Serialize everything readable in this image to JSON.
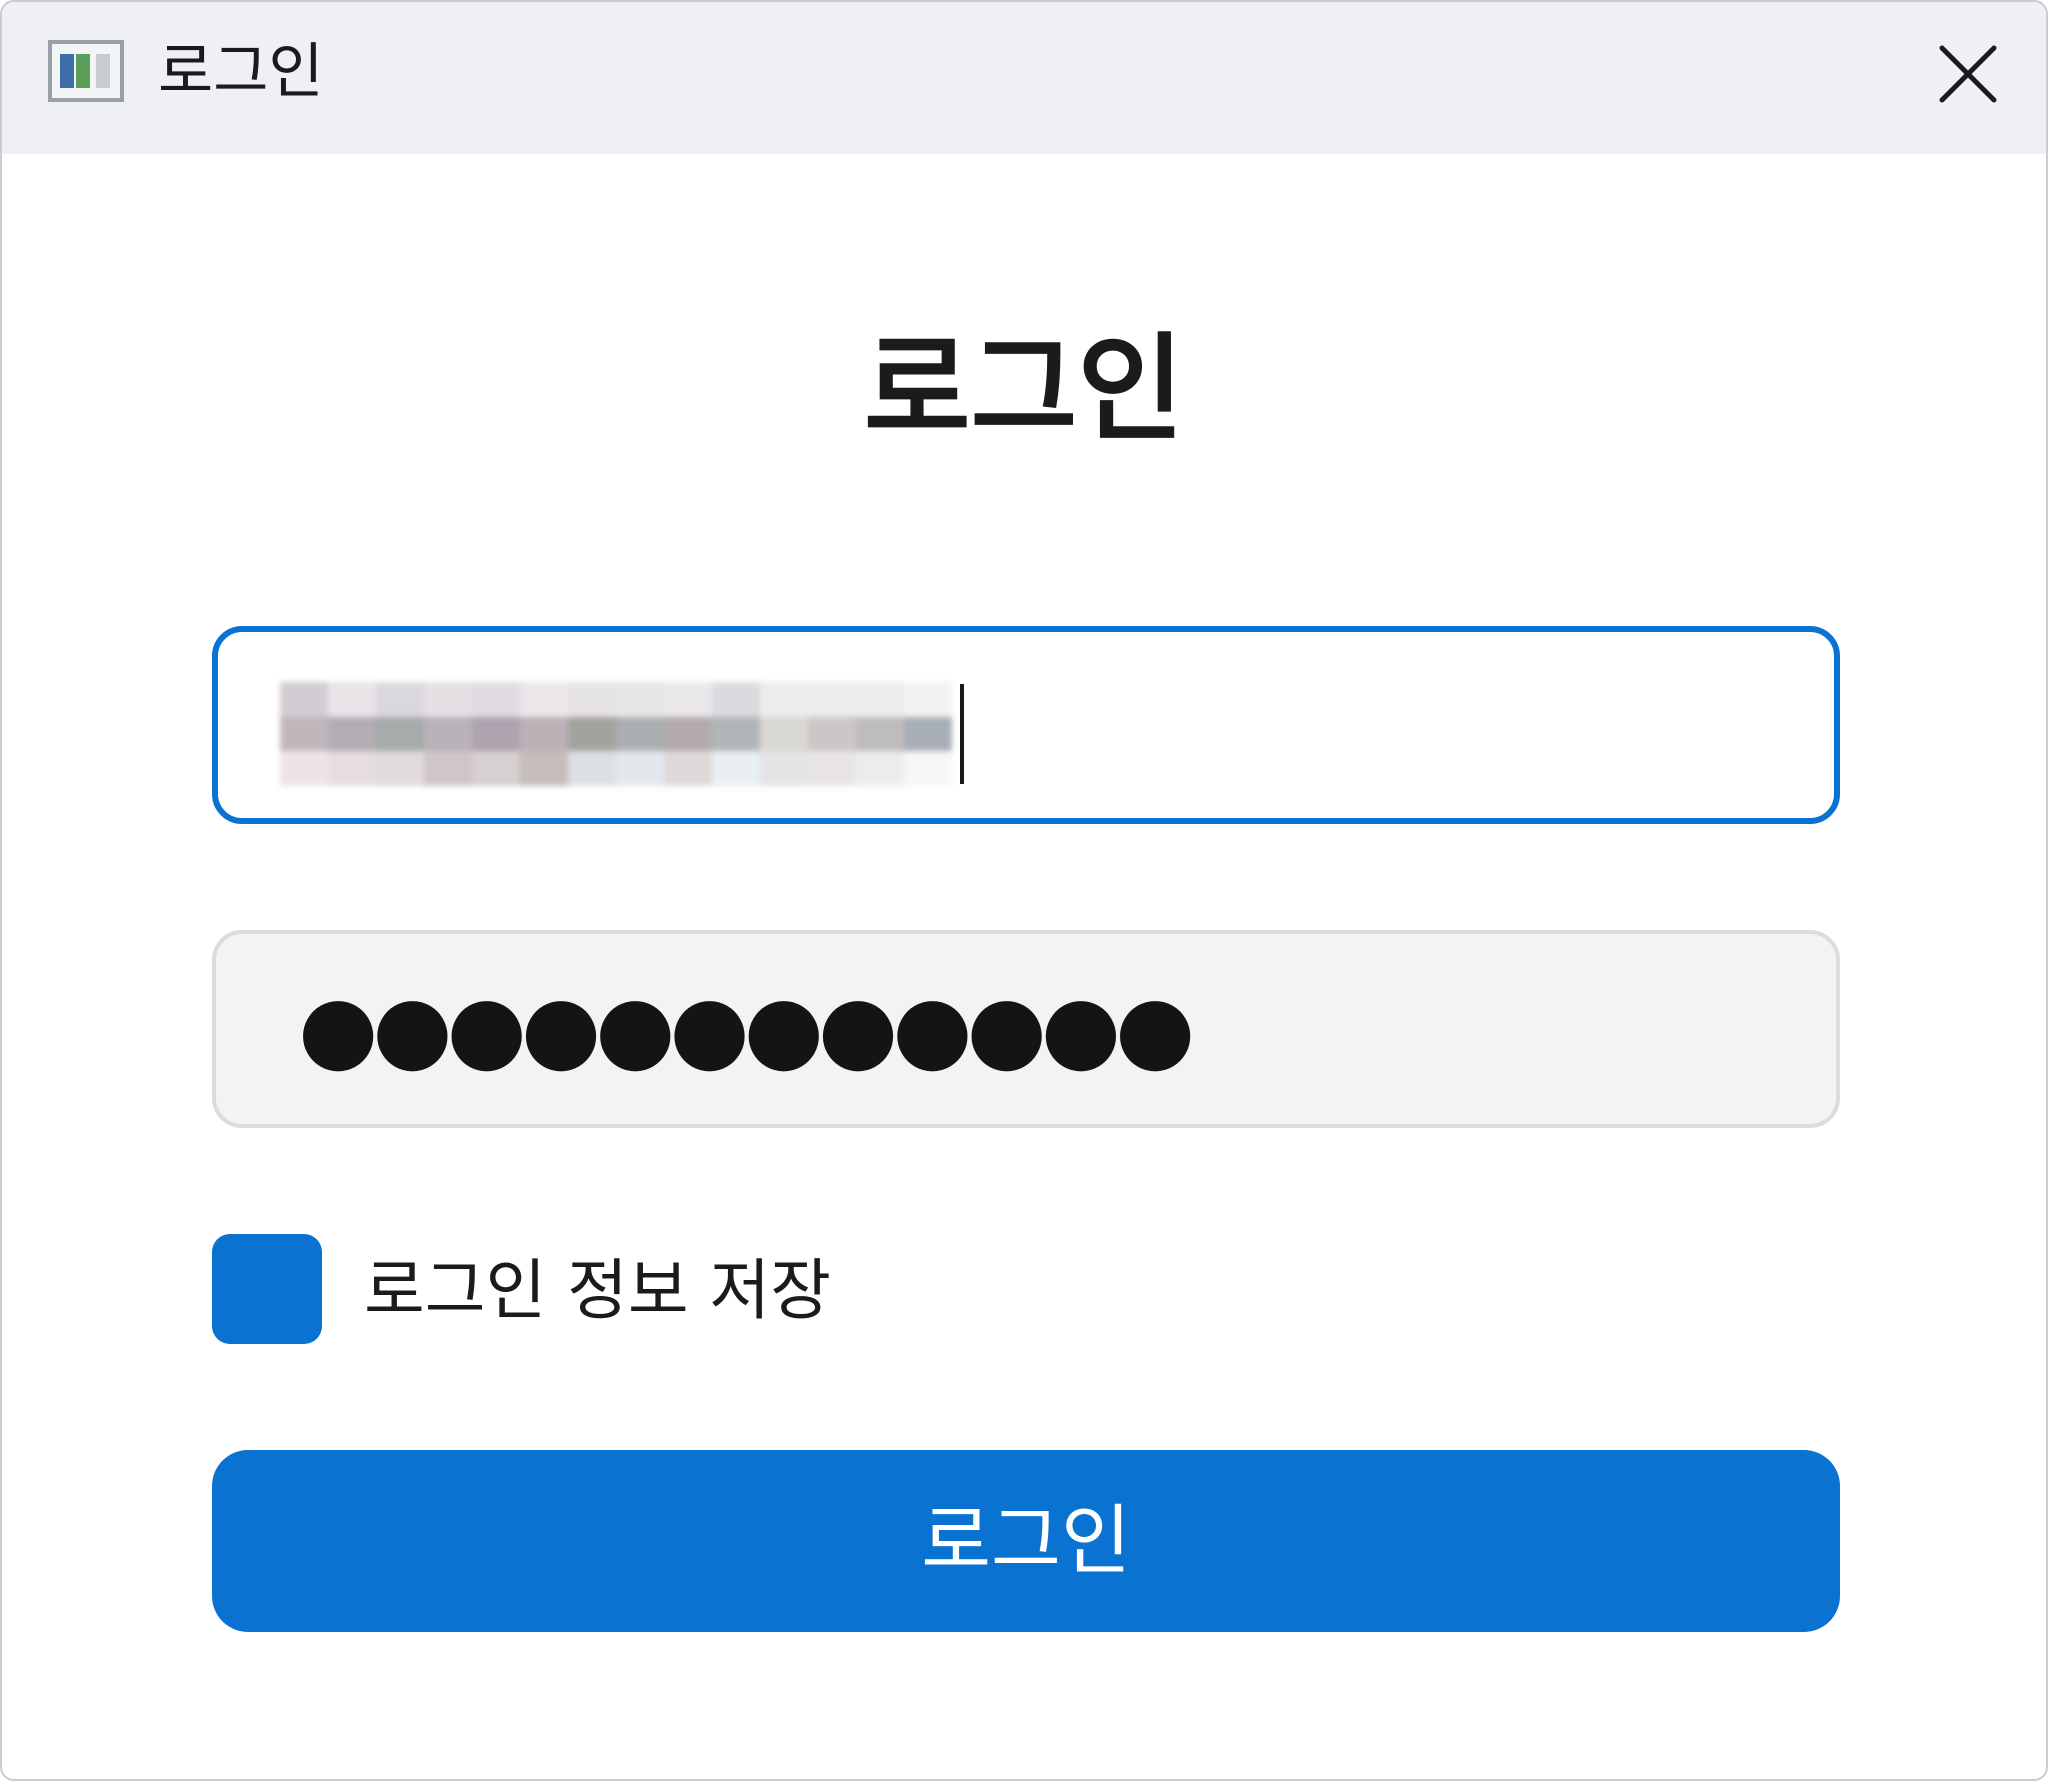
{
  "window": {
    "title": "로그인",
    "icons": {
      "app": "app-window-icon",
      "close": "close-icon"
    }
  },
  "form": {
    "heading": "로그인",
    "email": {
      "value": "",
      "state": "focused",
      "value_obscured": true
    },
    "password": {
      "masked_value": "●●●●●●●●●●●●"
    },
    "remember": {
      "label": "로그인 정보 저장",
      "checked": true
    },
    "submit_label": "로그인"
  },
  "colors": {
    "accent": "#0a72d1",
    "titlebar_bg": "#eef0f6",
    "password_bg": "#f3f3f3",
    "text": "#1b1b1b"
  }
}
